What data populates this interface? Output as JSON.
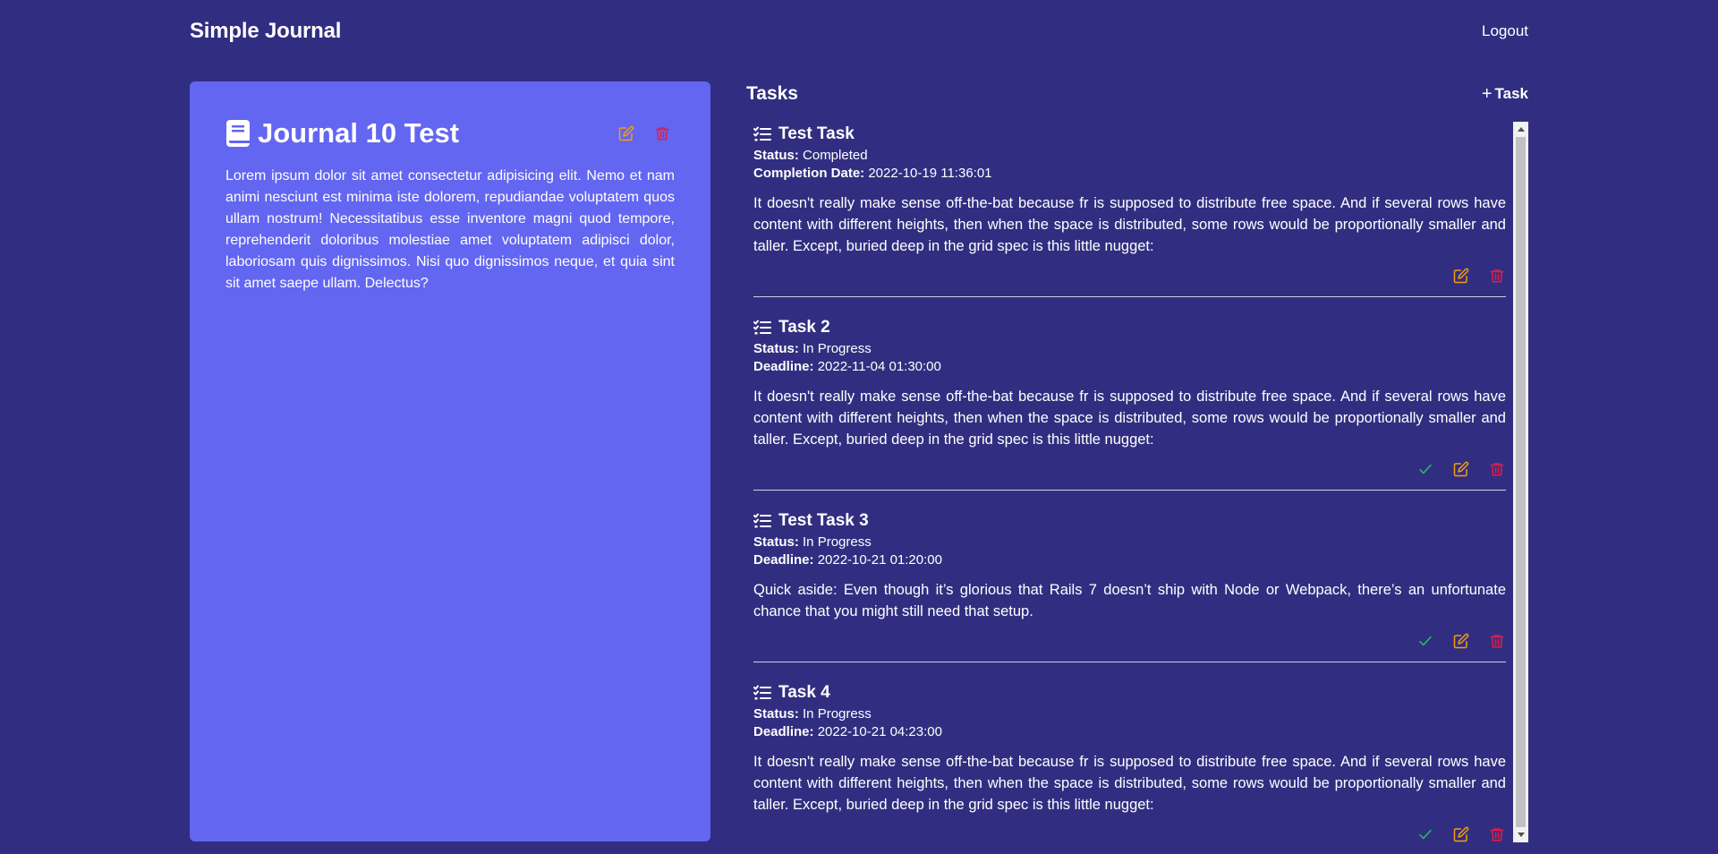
{
  "app": {
    "title": "Simple Journal",
    "logout_label": "Logout"
  },
  "journal": {
    "title": "Journal 10 Test",
    "body": "Lorem ipsum dolor sit amet consectetur adipisicing elit. Nemo et nam animi nesciunt est minima iste dolorem, repudiandae voluptatem quos ullam nostrum! Necessitatibus esse inventore magni quod tempore, reprehenderit doloribus molestiae amet voluptatem adipisci dolor, laboriosam quis dignissimos. Nisi quo dignissimos neque, et quia sint sit amet saepe ullam. Delectus?"
  },
  "tasks_panel": {
    "title": "Tasks",
    "add_label": "Task"
  },
  "tasks": [
    {
      "title": "Test Task",
      "status_label": "Status:",
      "status": "Completed",
      "date_label": "Completion Date:",
      "date": "2022-10-19 11:36:01",
      "description": "It doesn't really make sense off-the-bat because fr is supposed to distribute free space. And if several rows have content with different heights, then when the space is distributed, some rows would be proportionally smaller and taller. Except, buried deep in the grid spec is this little nugget:"
    },
    {
      "title": "Task 2",
      "status_label": "Status:",
      "status": "In Progress",
      "date_label": "Deadline:",
      "date": "2022-11-04 01:30:00",
      "description": "It doesn't really make sense off-the-bat because fr is supposed to distribute free space. And if several rows have content with different heights, then when the space is distributed, some rows would be proportionally smaller and taller. Except, buried deep in the grid spec is this little nugget:"
    },
    {
      "title": "Test Task 3",
      "status_label": "Status:",
      "status": "In Progress",
      "date_label": "Deadline:",
      "date": "2022-10-21 01:20:00",
      "description": "Quick aside: Even though it’s glorious that Rails 7 doesn’t ship with Node or Webpack, there’s an unfortunate chance that you might still need that setup."
    },
    {
      "title": "Task 4",
      "status_label": "Status:",
      "status": "In Progress",
      "date_label": "Deadline:",
      "date": "2022-10-21 04:23:00",
      "description": "It doesn't really make sense off-the-bat because fr is supposed to distribute free space. And if several rows have content with different heights, then when the space is distributed, some rows would be proportionally smaller and taller. Except, buried deep in the grid spec is this little nugget:"
    }
  ],
  "icons": {
    "journal": "book-icon",
    "task": "checklist-icon",
    "edit": "edit-icon",
    "delete": "trash-icon",
    "complete": "check-icon"
  },
  "colors": {
    "background": "#312e81",
    "card": "#6366f1",
    "edit": "#f59e0b",
    "delete": "#e11d48",
    "complete": "#22c55e"
  }
}
